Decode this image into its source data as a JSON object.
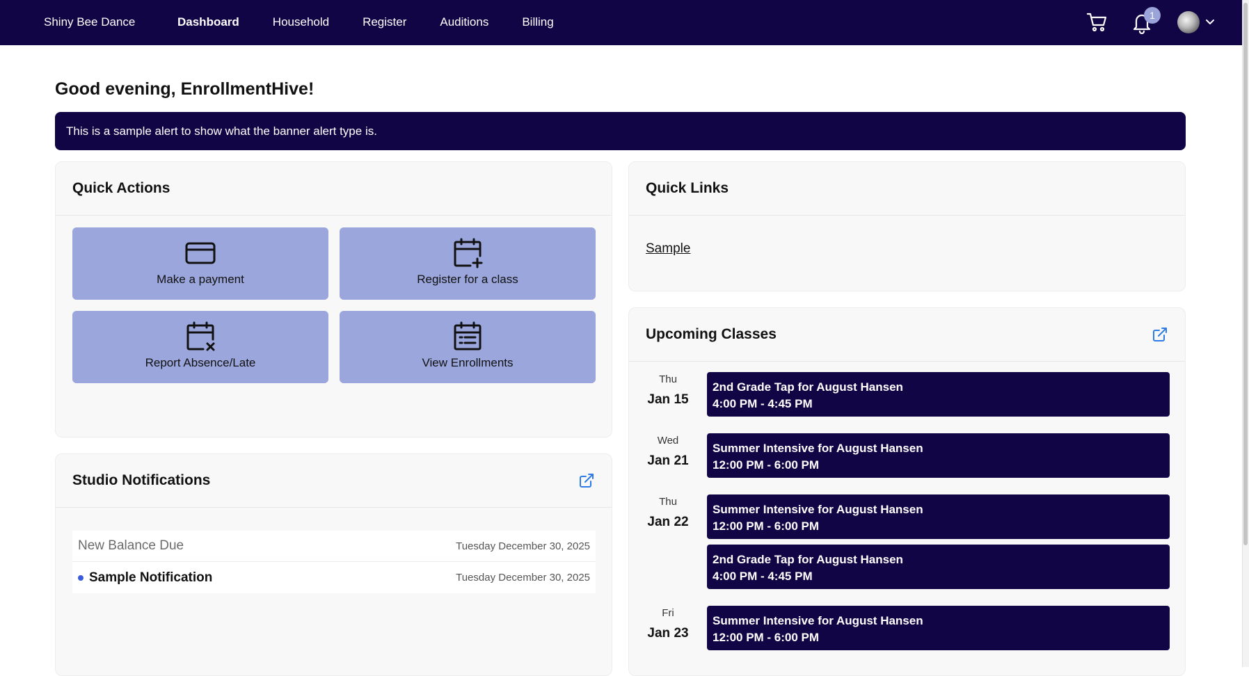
{
  "nav": {
    "brand": "Shiny Bee Dance",
    "links": [
      "Dashboard",
      "Household",
      "Register",
      "Auditions",
      "Billing"
    ],
    "notification_count": "1",
    "colors": {
      "nav_bg": "#120545",
      "accent": "#9aa6dc"
    }
  },
  "greeting": "Good evening, EnrollmentHive!",
  "alert": "This is a sample alert to show what the banner alert type is.",
  "quick_actions": {
    "title": "Quick Actions",
    "items": [
      {
        "label": "Make a payment",
        "icon": "credit-card-icon"
      },
      {
        "label": "Register for a class",
        "icon": "calendar-plus-icon"
      },
      {
        "label": "Report Absence/Late",
        "icon": "calendar-x-icon"
      },
      {
        "label": "View Enrollments",
        "icon": "calendar-list-icon"
      }
    ]
  },
  "studio_notifications": {
    "title": "Studio Notifications",
    "items": [
      {
        "title": "New Balance Due",
        "date": "Tuesday December 30, 2025",
        "unread": false
      },
      {
        "title": "Sample Notification",
        "date": "Tuesday December 30, 2025",
        "unread": true
      }
    ]
  },
  "quick_links": {
    "title": "Quick Links",
    "links": [
      "Sample"
    ]
  },
  "upcoming_classes": {
    "title": "Upcoming Classes",
    "days": [
      {
        "dow": "Thu",
        "date": "Jan 15",
        "events": [
          {
            "name": "2nd Grade Tap for August Hansen",
            "time": "4:00 PM - 4:45 PM"
          }
        ]
      },
      {
        "dow": "Wed",
        "date": "Jan 21",
        "events": [
          {
            "name": "Summer Intensive for August Hansen",
            "time": "12:00 PM - 6:00 PM"
          }
        ]
      },
      {
        "dow": "Thu",
        "date": "Jan 22",
        "events": [
          {
            "name": "Summer Intensive for August Hansen",
            "time": "12:00 PM - 6:00 PM"
          },
          {
            "name": "2nd Grade Tap for August Hansen",
            "time": "4:00 PM - 4:45 PM"
          }
        ]
      },
      {
        "dow": "Fri",
        "date": "Jan 23",
        "events": [
          {
            "name": "Summer Intensive for August Hansen",
            "time": "12:00 PM - 6:00 PM"
          }
        ]
      }
    ]
  }
}
